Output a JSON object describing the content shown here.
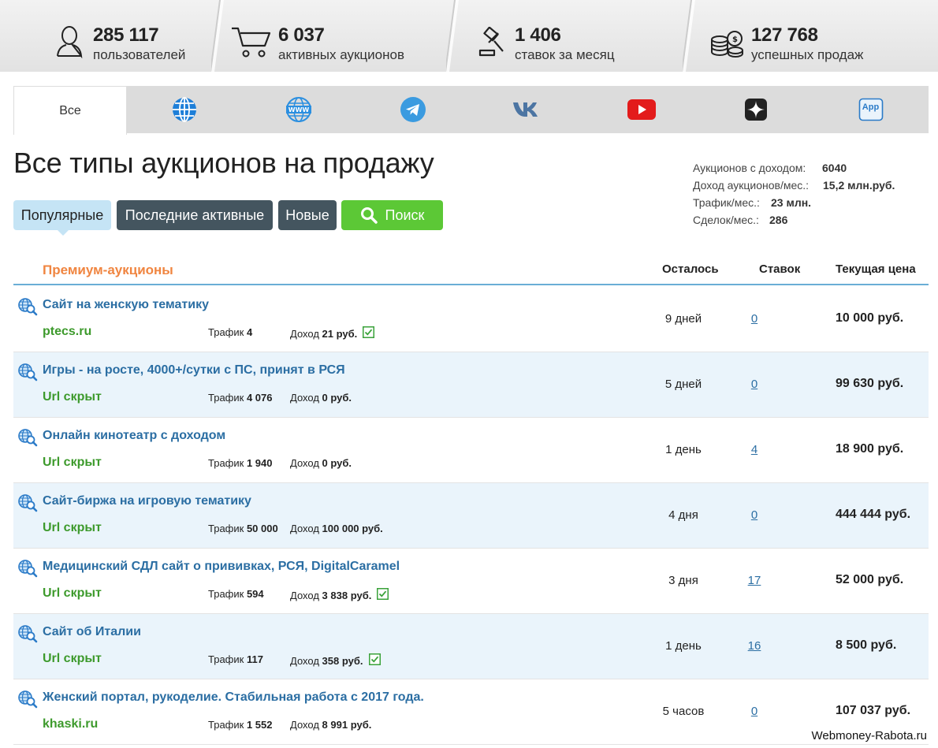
{
  "stats": [
    {
      "icon": "user-icon",
      "number": "285 117",
      "label": "пользователей"
    },
    {
      "icon": "cart-icon",
      "number": "6 037",
      "label": "активных аукционов"
    },
    {
      "icon": "gavel-icon",
      "number": "1 406",
      "label": "ставок за месяц"
    },
    {
      "icon": "coins-icon",
      "number": "127 768",
      "label": "успешных продаж"
    }
  ],
  "tabs": [
    {
      "label": "Все",
      "icon": null,
      "active": true
    },
    {
      "label": "",
      "icon": "globe-icon"
    },
    {
      "label": "",
      "icon": "www-globe-icon"
    },
    {
      "label": "",
      "icon": "telegram-icon"
    },
    {
      "label": "",
      "icon": "vk-icon"
    },
    {
      "label": "",
      "icon": "youtube-icon"
    },
    {
      "label": "",
      "icon": "zen-icon"
    },
    {
      "label": "App",
      "icon": "app-icon"
    }
  ],
  "page_title": "Все типы аукционов на продажу",
  "summary": [
    {
      "key": "Аукционов с доходом:",
      "value": "6040"
    },
    {
      "key": "Доход аукционов/мес.:",
      "value": "15,2 млн.руб."
    },
    {
      "key": "Трафик/мес.:",
      "value": "23 млн."
    },
    {
      "key": "Сделок/мес.:",
      "value": "286"
    }
  ],
  "filters": {
    "popular": "Популярные",
    "last_active": "Последние активные",
    "new": "Новые",
    "search": "Поиск"
  },
  "table": {
    "section": "Премиум-аукционы",
    "col_left": "Осталось",
    "col_bids": "Ставок",
    "col_price": "Текущая цена",
    "traffic_label": "Трафик",
    "income_label": "Доход",
    "rows": [
      {
        "title": "Сайт на женскую тематику",
        "url": "ptecs.ru",
        "traffic": "4",
        "income": "21 руб.",
        "verified": true,
        "left": "9 дней",
        "bids": "0",
        "price": "10 000 руб."
      },
      {
        "title": "Игры - на росте, 4000+/сутки с ПС, принят в РСЯ",
        "url": "Url скрыт",
        "traffic": "4 076",
        "income": "0 руб.",
        "verified": false,
        "left": "5 дней",
        "bids": "0",
        "price": "99 630 руб."
      },
      {
        "title": "Онлайн кинотеатр с доходом",
        "url": "Url скрыт",
        "traffic": "1 940",
        "income": "0 руб.",
        "verified": false,
        "left": "1 день",
        "bids": "4",
        "price": "18 900 руб."
      },
      {
        "title": "Сайт-биржа на игровую тематику",
        "url": "Url скрыт",
        "traffic": "50 000",
        "income": "100 000 руб.",
        "verified": false,
        "left": "4 дня",
        "bids": "0",
        "price": "444 444 руб."
      },
      {
        "title": "Медицинский СДЛ сайт о прививках, РСЯ, DigitalCaramel",
        "url": "Url скрыт",
        "traffic": "594",
        "income": "3 838 руб.",
        "verified": true,
        "left": "3 дня",
        "bids": "17",
        "price": "52 000 руб."
      },
      {
        "title": "Сайт об Италии",
        "url": "Url скрыт",
        "traffic": "117",
        "income": "358 руб.",
        "verified": true,
        "left": "1 день",
        "bids": "16",
        "price": "8 500 руб."
      },
      {
        "title": "Женский портал, рукоделие. Стабильная работа с 2017 года.",
        "url": "khaski.ru",
        "traffic": "1 552",
        "income": "8 991 руб.",
        "verified": false,
        "left": "5 часов",
        "bids": "0",
        "price": "107 037 руб."
      }
    ]
  },
  "watermark": "Webmoney-Rabota.ru"
}
